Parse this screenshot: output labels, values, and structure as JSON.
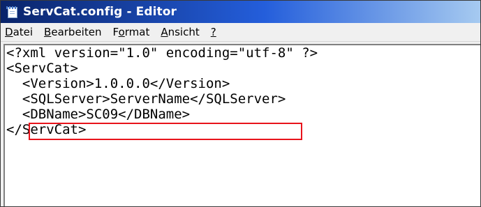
{
  "window": {
    "title": "ServCat.config - Editor",
    "icon": "notepad-icon"
  },
  "menu": [
    {
      "label_mnemonic": "D",
      "label_rest": "atei"
    },
    {
      "label_mnemonic": "B",
      "label_rest": "earbeiten"
    },
    {
      "label_pre": "F",
      "label_mnemonic": "o",
      "label_rest": "rmat"
    },
    {
      "label_mnemonic": "A",
      "label_rest": "nsicht"
    },
    {
      "label_mnemonic": "?",
      "label_rest": ""
    }
  ],
  "editor": {
    "lines": [
      "<?xml version=\"1.0\" encoding=\"utf-8\" ?>",
      "<ServCat>",
      "  <Version>1.0.0.0</Version>",
      "  <SQLServer>ServerName</SQLServer>",
      "  <DBName>SC09</DBName>",
      "</ServCat>"
    ],
    "highlighted_line": 3,
    "highlight_color": "#e8131b"
  }
}
